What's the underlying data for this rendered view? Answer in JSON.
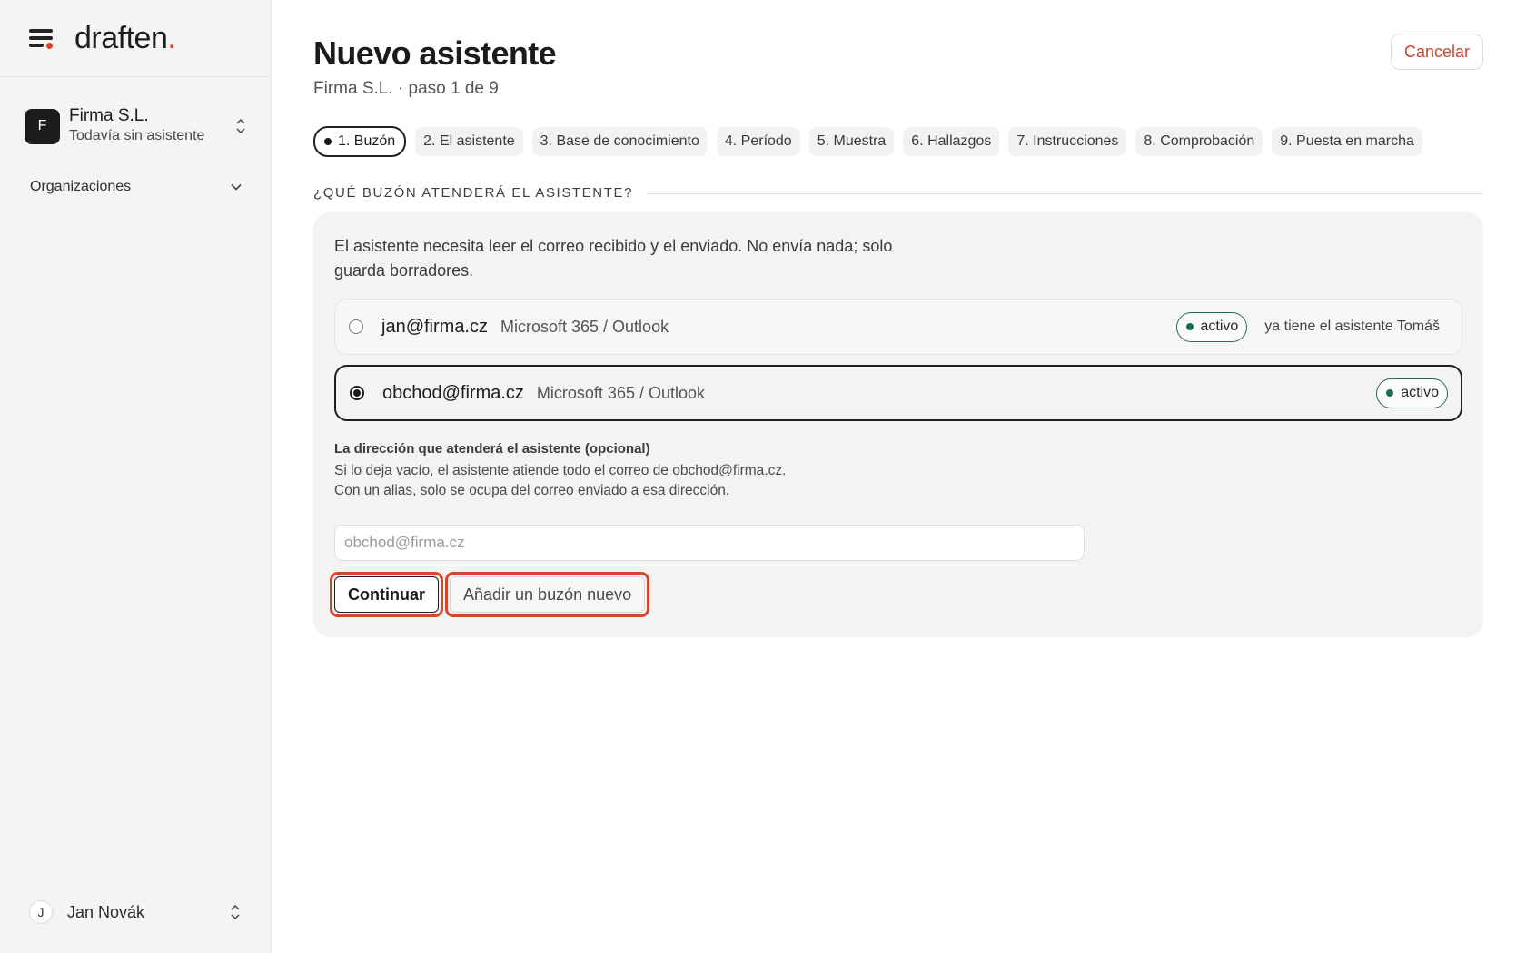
{
  "brand": {
    "logo_text": "draften",
    "logo_dot": "."
  },
  "sidebar": {
    "org": {
      "avatar_letter": "F",
      "name": "Firma S.L.",
      "subtitle": "Todavía sin asistente"
    },
    "section": {
      "label": "Organizaciones"
    },
    "user": {
      "avatar_letter": "J",
      "name": "Jan Novák"
    }
  },
  "header": {
    "title": "Nuevo asistente",
    "subtitle": "Firma S.L. · paso 1 de 9",
    "cancel_label": "Cancelar"
  },
  "steps": [
    {
      "label": "1. Buzón",
      "active": true
    },
    {
      "label": "2. El asistente"
    },
    {
      "label": "3. Base de conocimiento"
    },
    {
      "label": "4. Período"
    },
    {
      "label": "5. Muestra"
    },
    {
      "label": "6. Hallazgos"
    },
    {
      "label": "7. Instrucciones"
    },
    {
      "label": "8. Comprobación"
    },
    {
      "label": "9. Puesta en marcha"
    }
  ],
  "section": {
    "heading": "¿QUÉ BUZÓN ATENDERÁ EL ASISTENTE?"
  },
  "card": {
    "intro": "El asistente necesita leer el correo recibido y el enviado. No envía nada; solo guarda borradores.",
    "mailboxes": [
      {
        "email": "jan@firma.cz",
        "provider": "Microsoft 365 / Outlook",
        "status": "activo",
        "note": "ya tiene el asistente Tomáš",
        "selected": false
      },
      {
        "email": "obchod@firma.cz",
        "provider": "Microsoft 365 / Outlook",
        "status": "activo",
        "note": "",
        "selected": true
      }
    ],
    "field": {
      "label": "La dirección que atenderá el asistente (opcional)",
      "help": "Si lo deja vacío, el asistente atiende todo el correo de obchod@firma.cz. Con un alias, solo se ocupa del correo enviado a esa dirección.",
      "placeholder": "obchod@firma.cz",
      "value": ""
    },
    "continue_label": "Continuar",
    "add_mailbox_label": "Añadir un buzón nuevo"
  },
  "colors": {
    "accent": "#d8432c",
    "status_green": "#1e6b4f",
    "cancel_text": "#c0492f"
  },
  "icons": [
    "menu-icon",
    "updown-icon",
    "chevron-down-icon",
    "radio-icon",
    "status-dot-icon"
  ]
}
